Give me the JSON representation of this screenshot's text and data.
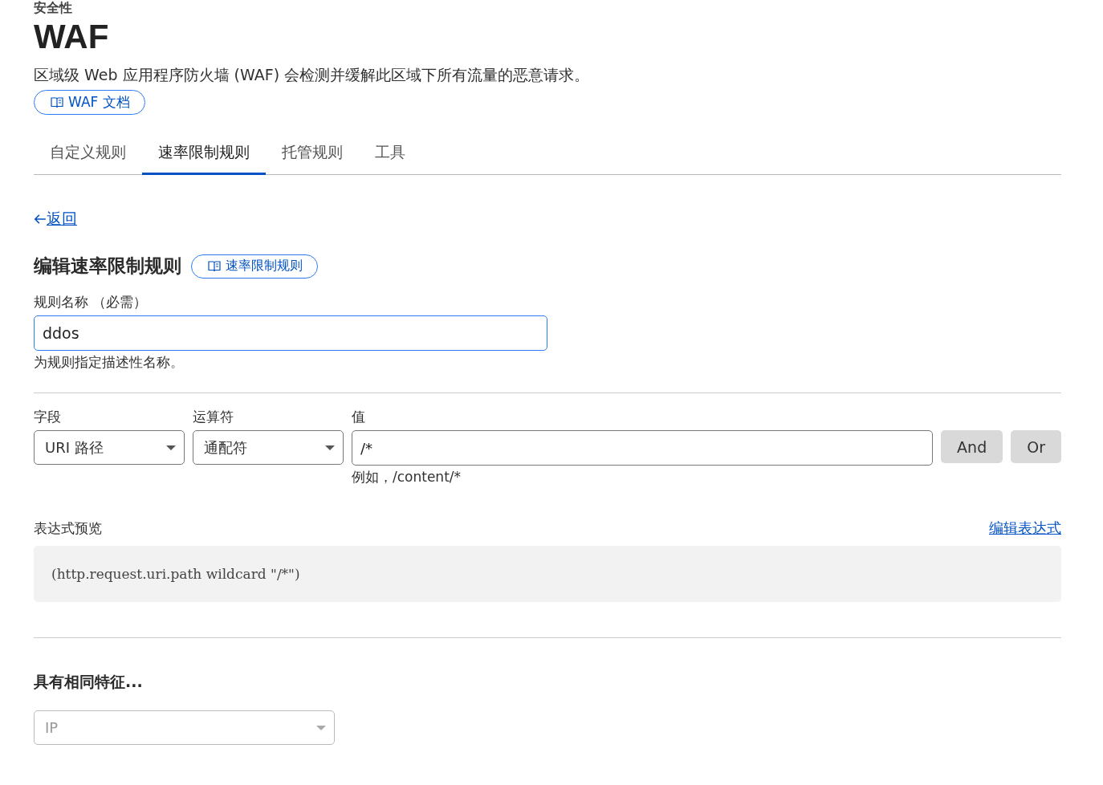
{
  "breadcrumb": "安全性",
  "title": "WAF",
  "description": "区域级 Web 应用程序防火墙 (WAF) 会检测并缓解此区域下所有流量的恶意请求。",
  "docs_button": "WAF 文档",
  "tabs": [
    {
      "label": "自定义规则",
      "selected": false
    },
    {
      "label": "速率限制规则",
      "selected": true
    },
    {
      "label": "托管规则",
      "selected": false
    },
    {
      "label": "工具",
      "selected": false
    }
  ],
  "back_link": "返回",
  "section_title": "编辑速率限制规则",
  "section_docs_button": "速率限制规则",
  "rule_name": {
    "label": "规则名称 （必需）",
    "value": "ddos",
    "hint": "为规则指定描述性名称。"
  },
  "expression": {
    "field": {
      "label": "字段",
      "value": "URI 路径"
    },
    "operator": {
      "label": "运算符",
      "value": "通配符"
    },
    "value": {
      "label": "值",
      "value": "/*",
      "hint": "例如，/content/*"
    },
    "buttons": [
      "And",
      "Or"
    ]
  },
  "preview": {
    "label": "表达式预览",
    "edit_link": "编辑表达式",
    "code": "(http.request.uri.path wildcard \"/*\")"
  },
  "characteristics": {
    "title": "具有相同特征...",
    "select": {
      "value": "IP",
      "disabled": true
    }
  }
}
